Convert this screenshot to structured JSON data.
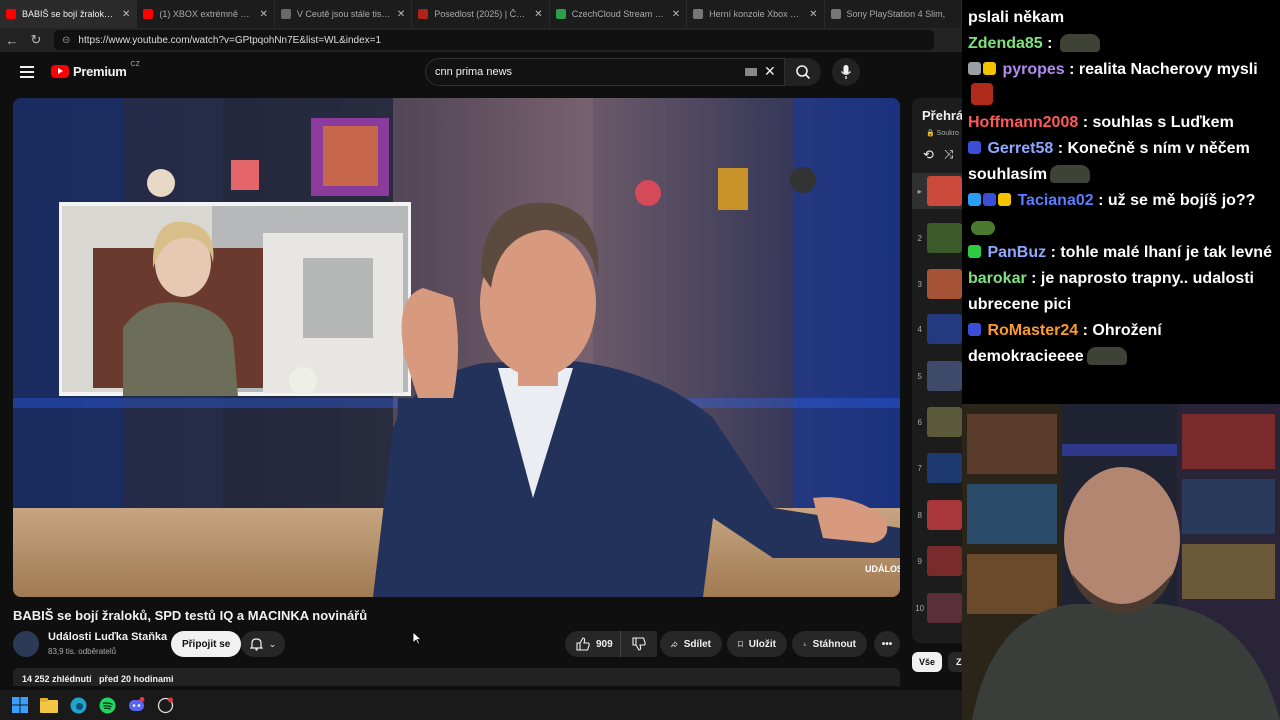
{
  "browser": {
    "tabs": [
      {
        "title": "BABIŠ se bojí žraloků, SP",
        "favicon_color": "#ff0000",
        "active": true
      },
      {
        "title": "(1) XBOX extrémně zdražil.",
        "favicon_color": "#ff0000",
        "active": false
      },
      {
        "title": "V Ceutě jsou stále tisíce mig",
        "favicon_color": "#6a6a6a",
        "active": false
      },
      {
        "title": "Posedlost (2025) | ČSFD.cz",
        "favicon_color": "#b32216",
        "active": false
      },
      {
        "title": "CzechCloud Stream - Watch",
        "favicon_color": "#2e9e4a",
        "active": false
      },
      {
        "title": "Herní konzole Xbox Series |",
        "favicon_color": "#777777",
        "active": false
      },
      {
        "title": "Sony PlayStation 4 Slim,",
        "favicon_color": "#777777",
        "active": false
      }
    ],
    "url": "https://www.youtube.com/watch?v=GPtpqohNn7E&list=WL&index=1"
  },
  "youtube": {
    "logo_text": "Premium",
    "logo_region": "CZ",
    "search_query": "cnn prima news",
    "video": {
      "title": "BABIŠ se bojí žraloků, SPD testů IQ a MACINKA novinářů",
      "watermark": "UDÁLOSTI"
    },
    "channel": {
      "name": "Události Luďka Staňka",
      "subscribers": "83,9 tis. odběratelů",
      "join_label": "Připojit se"
    },
    "actions": {
      "likes": "909",
      "share": "Sdílet",
      "save": "Uložit",
      "download": "Stáhnout"
    },
    "description": {
      "views": "14 252 zhlédnutí",
      "age": "před 20 hodinami"
    },
    "playlist": {
      "title": "Přehrá",
      "subtitle": "Soukro",
      "items": [
        "2",
        "3",
        "4",
        "5",
        "6",
        "7",
        "8",
        "9",
        "10"
      ],
      "chip_all": "Vše",
      "chip_next": "Z"
    }
  },
  "chat": {
    "messages": [
      {
        "user": "",
        "text": "pslali někam",
        "color": "#ffffff"
      },
      {
        "user": "Zdenda85",
        "text": " : ",
        "color": "#7ee27e",
        "emote": "pepe"
      },
      {
        "user": "pyropes",
        "text": " : realita Nacherovy mysli",
        "color": "#b08cf0",
        "badges": [
          "#9aa0a6",
          "#f5c400"
        ],
        "emote2": "red"
      },
      {
        "user": "Hoffmann2008",
        "text": " : souhlas s Luďkem",
        "color": "#ff5a5a"
      },
      {
        "user": "Gerret58",
        "text": " : Konečně s ním v něčem souhlasím",
        "color": "#8fa8ff",
        "badges": [
          "#3a4ed6"
        ],
        "emote": "pepe"
      },
      {
        "user": "Taciana02",
        "text": " : už se mě bojíš jo??",
        "color": "#5b7cff",
        "badges": [
          "#2a9df4",
          "#3a4ed6",
          "#f5c400"
        ],
        "emote3": "frog"
      },
      {
        "user": "PanBuz",
        "text": " : tohle malé lhaní je tak levné",
        "color": "#8fa8ff",
        "badges": [
          "#2ecc40"
        ]
      },
      {
        "user": "barokar",
        "text": " : je naprosto trapny.. udalosti ubrecene pici",
        "color": "#7ee27e"
      },
      {
        "user": "RoMaster24",
        "text": " : Ohrožení demokracieeee",
        "color": "#ff9a2e",
        "badges": [
          "#3a4ed6"
        ],
        "emote": "pepe"
      }
    ]
  },
  "icons": {
    "menu": "hamburger-icon",
    "search": "search-icon",
    "mic": "mic-icon",
    "bell": "bell-icon",
    "like": "thumb-up-icon",
    "dislike": "thumb-down-icon",
    "share": "share-icon",
    "save": "bookmark-icon",
    "download": "download-icon",
    "more": "more-icon"
  }
}
